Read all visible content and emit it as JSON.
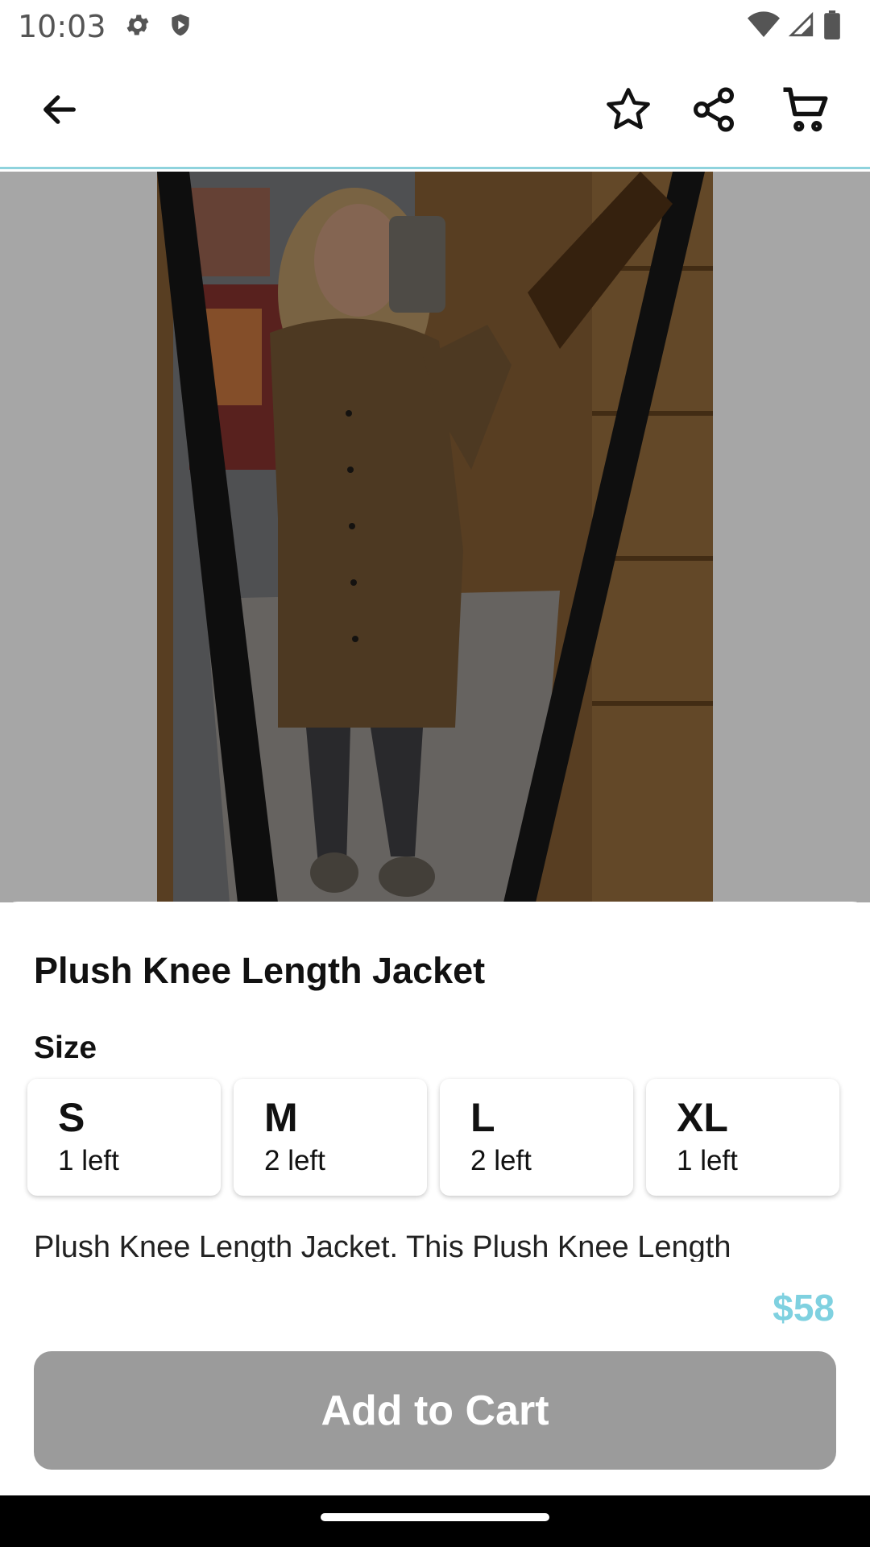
{
  "status_bar": {
    "time": "10:03",
    "left_icons": [
      "settings-icon",
      "shield-icon"
    ],
    "right_icons": [
      "wifi-icon",
      "signal-icon",
      "battery-icon"
    ]
  },
  "app_bar": {
    "icons": [
      "back-arrow-icon",
      "star-icon",
      "share-icon",
      "cart-icon"
    ]
  },
  "product": {
    "title": "Plush Knee Length Jacket",
    "size_label": "Size",
    "sizes": [
      {
        "name": "S",
        "stock": "1 left"
      },
      {
        "name": "M",
        "stock": "2 left"
      },
      {
        "name": "L",
        "stock": "2 left"
      },
      {
        "name": "XL",
        "stock": "1 left"
      }
    ],
    "description": "Plush Knee Length Jacket. This Plush Knee Length"
  },
  "footer": {
    "price": "$58",
    "add_to_cart_label": "Add to Cart"
  },
  "colors": {
    "accent": "#7fd1e0",
    "button_disabled": "#9b9b9b",
    "overlay": "#a6a6a6"
  }
}
